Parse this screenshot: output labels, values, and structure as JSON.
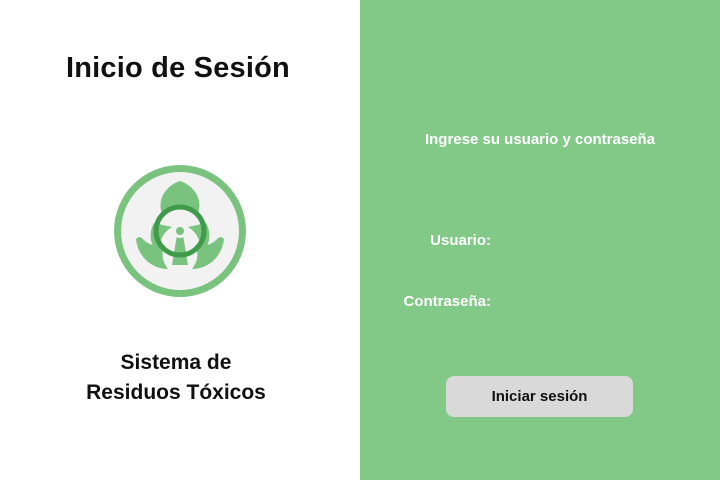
{
  "login": {
    "title": "Inicio de Sesión",
    "system_name_line1": "Sistema de",
    "system_name_line2": "Residuos Tóxicos",
    "logo_icon": "biohazard-icon",
    "instructions": "Ingrese su usuario y contraseña",
    "username_label": "Usuario:",
    "username_value": "",
    "password_label": "Contraseña:",
    "password_value": "",
    "submit_label": "Iniciar sesión"
  },
  "colors": {
    "panel_green": "#82c887",
    "logo_green": "#79c37f",
    "logo_background": "#f1f2f1",
    "button_gray": "#d9d9d9"
  }
}
